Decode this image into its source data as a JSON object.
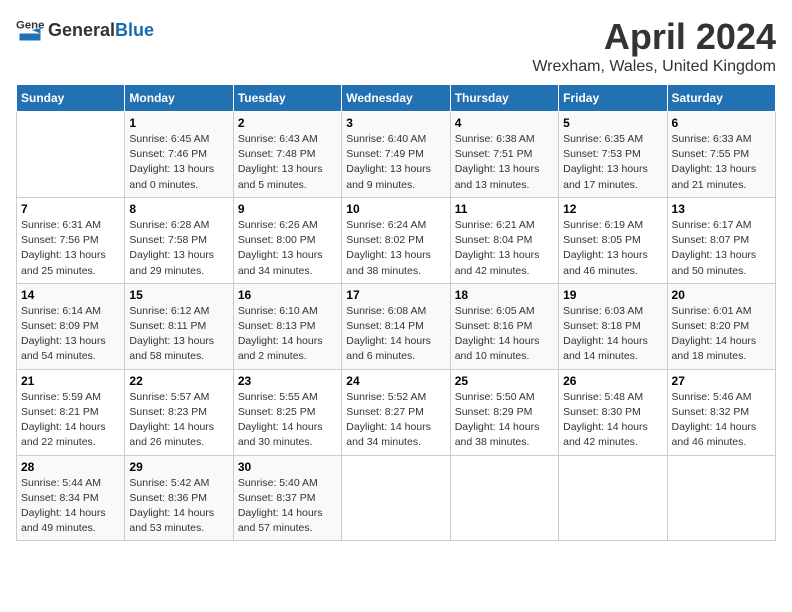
{
  "header": {
    "logo_general": "General",
    "logo_blue": "Blue",
    "month": "April 2024",
    "location": "Wrexham, Wales, United Kingdom"
  },
  "days_of_week": [
    "Sunday",
    "Monday",
    "Tuesday",
    "Wednesday",
    "Thursday",
    "Friday",
    "Saturday"
  ],
  "weeks": [
    [
      {
        "day": "",
        "info": ""
      },
      {
        "day": "1",
        "info": "Sunrise: 6:45 AM\nSunset: 7:46 PM\nDaylight: 13 hours\nand 0 minutes."
      },
      {
        "day": "2",
        "info": "Sunrise: 6:43 AM\nSunset: 7:48 PM\nDaylight: 13 hours\nand 5 minutes."
      },
      {
        "day": "3",
        "info": "Sunrise: 6:40 AM\nSunset: 7:49 PM\nDaylight: 13 hours\nand 9 minutes."
      },
      {
        "day": "4",
        "info": "Sunrise: 6:38 AM\nSunset: 7:51 PM\nDaylight: 13 hours\nand 13 minutes."
      },
      {
        "day": "5",
        "info": "Sunrise: 6:35 AM\nSunset: 7:53 PM\nDaylight: 13 hours\nand 17 minutes."
      },
      {
        "day": "6",
        "info": "Sunrise: 6:33 AM\nSunset: 7:55 PM\nDaylight: 13 hours\nand 21 minutes."
      }
    ],
    [
      {
        "day": "7",
        "info": "Sunrise: 6:31 AM\nSunset: 7:56 PM\nDaylight: 13 hours\nand 25 minutes."
      },
      {
        "day": "8",
        "info": "Sunrise: 6:28 AM\nSunset: 7:58 PM\nDaylight: 13 hours\nand 29 minutes."
      },
      {
        "day": "9",
        "info": "Sunrise: 6:26 AM\nSunset: 8:00 PM\nDaylight: 13 hours\nand 34 minutes."
      },
      {
        "day": "10",
        "info": "Sunrise: 6:24 AM\nSunset: 8:02 PM\nDaylight: 13 hours\nand 38 minutes."
      },
      {
        "day": "11",
        "info": "Sunrise: 6:21 AM\nSunset: 8:04 PM\nDaylight: 13 hours\nand 42 minutes."
      },
      {
        "day": "12",
        "info": "Sunrise: 6:19 AM\nSunset: 8:05 PM\nDaylight: 13 hours\nand 46 minutes."
      },
      {
        "day": "13",
        "info": "Sunrise: 6:17 AM\nSunset: 8:07 PM\nDaylight: 13 hours\nand 50 minutes."
      }
    ],
    [
      {
        "day": "14",
        "info": "Sunrise: 6:14 AM\nSunset: 8:09 PM\nDaylight: 13 hours\nand 54 minutes."
      },
      {
        "day": "15",
        "info": "Sunrise: 6:12 AM\nSunset: 8:11 PM\nDaylight: 13 hours\nand 58 minutes."
      },
      {
        "day": "16",
        "info": "Sunrise: 6:10 AM\nSunset: 8:13 PM\nDaylight: 14 hours\nand 2 minutes."
      },
      {
        "day": "17",
        "info": "Sunrise: 6:08 AM\nSunset: 8:14 PM\nDaylight: 14 hours\nand 6 minutes."
      },
      {
        "day": "18",
        "info": "Sunrise: 6:05 AM\nSunset: 8:16 PM\nDaylight: 14 hours\nand 10 minutes."
      },
      {
        "day": "19",
        "info": "Sunrise: 6:03 AM\nSunset: 8:18 PM\nDaylight: 14 hours\nand 14 minutes."
      },
      {
        "day": "20",
        "info": "Sunrise: 6:01 AM\nSunset: 8:20 PM\nDaylight: 14 hours\nand 18 minutes."
      }
    ],
    [
      {
        "day": "21",
        "info": "Sunrise: 5:59 AM\nSunset: 8:21 PM\nDaylight: 14 hours\nand 22 minutes."
      },
      {
        "day": "22",
        "info": "Sunrise: 5:57 AM\nSunset: 8:23 PM\nDaylight: 14 hours\nand 26 minutes."
      },
      {
        "day": "23",
        "info": "Sunrise: 5:55 AM\nSunset: 8:25 PM\nDaylight: 14 hours\nand 30 minutes."
      },
      {
        "day": "24",
        "info": "Sunrise: 5:52 AM\nSunset: 8:27 PM\nDaylight: 14 hours\nand 34 minutes."
      },
      {
        "day": "25",
        "info": "Sunrise: 5:50 AM\nSunset: 8:29 PM\nDaylight: 14 hours\nand 38 minutes."
      },
      {
        "day": "26",
        "info": "Sunrise: 5:48 AM\nSunset: 8:30 PM\nDaylight: 14 hours\nand 42 minutes."
      },
      {
        "day": "27",
        "info": "Sunrise: 5:46 AM\nSunset: 8:32 PM\nDaylight: 14 hours\nand 46 minutes."
      }
    ],
    [
      {
        "day": "28",
        "info": "Sunrise: 5:44 AM\nSunset: 8:34 PM\nDaylight: 14 hours\nand 49 minutes."
      },
      {
        "day": "29",
        "info": "Sunrise: 5:42 AM\nSunset: 8:36 PM\nDaylight: 14 hours\nand 53 minutes."
      },
      {
        "day": "30",
        "info": "Sunrise: 5:40 AM\nSunset: 8:37 PM\nDaylight: 14 hours\nand 57 minutes."
      },
      {
        "day": "",
        "info": ""
      },
      {
        "day": "",
        "info": ""
      },
      {
        "day": "",
        "info": ""
      },
      {
        "day": "",
        "info": ""
      }
    ]
  ]
}
